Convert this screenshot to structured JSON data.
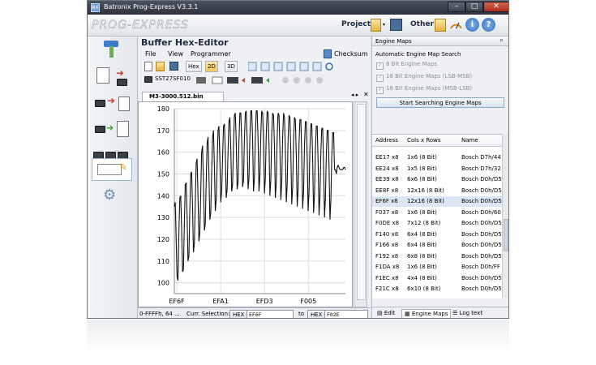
{
  "window": {
    "title": "Batronix Prog-Express V3.3.1",
    "app_icon": "BX",
    "min": "–",
    "max": "□",
    "close": "✕"
  },
  "header": {
    "logo": "PROG-EXPRESS",
    "project_label": "Project",
    "other_label": "Other"
  },
  "editor": {
    "title": "Buffer Hex-Editor",
    "menu": [
      "File",
      "View",
      "Programmer"
    ],
    "checksum_label": "Checksum",
    "hex_label": "Hex",
    "view_2d": "2D",
    "view_3d": "3D",
    "device": "SST27SF010",
    "doc_tab": "M3-3000.512.bin",
    "status": {
      "range": "0-FFFFh, 64 ...",
      "curr_selection_label": "Curr. Selection:",
      "hex": "HEX",
      "from": "EF6F",
      "to_label": "to",
      "to": "F02E"
    }
  },
  "engine_maps": {
    "title": "Engine Maps",
    "pin": "ᵖ",
    "search_label": "Automatic Engine Map Search",
    "options": [
      "8 Bit Engine Maps",
      "16 Bit Engine Maps (LSB-MSB)",
      "16 Bit Engine Maps (MSB-LSB)"
    ],
    "start_button": "Start Searching Engine Maps",
    "columns": [
      "Address",
      "Cols x Rows",
      "Name"
    ],
    "rows": [
      [
        "EE17 x8",
        "1x6 (8 Bit)",
        "Bosch D7h/44"
      ],
      [
        "EE24 x8",
        "1x5 (8 Bit)",
        "Bosch D7h/32"
      ],
      [
        "EE39 x8",
        "6x6 (8 Bit)",
        "Bosch D0h/D5"
      ],
      [
        "EE8F x8",
        "12x16 (8 Bit)",
        "Bosch D0h/D5"
      ],
      [
        "EF6F x8",
        "12x16 (8 Bit)",
        "Bosch D0h/D5"
      ],
      [
        "F037 x8",
        "1x6 (8 Bit)",
        "Bosch D0h/60"
      ],
      [
        "F0DE x8",
        "7x12 (8 Bit)",
        "Bosch D0h/D5"
      ],
      [
        "F140 x8",
        "6x4 (8 Bit)",
        "Bosch D0h/D5"
      ],
      [
        "F166 x8",
        "6x4 (8 Bit)",
        "Bosch D0h/D5"
      ],
      [
        "F192 x8",
        "8x8 (8 Bit)",
        "Bosch D0h/D5"
      ],
      [
        "F1DA x8",
        "1x6 (8 Bit)",
        "Bosch D0h/FF"
      ],
      [
        "F1EC x8",
        "4x4 (8 Bit)",
        "Bosch D0h/D5"
      ],
      [
        "F21C x8",
        "6x10 (8 Bit)",
        "Bosch D0h/D5"
      ]
    ],
    "tabs": [
      "Edit",
      "Engine Maps",
      "Log text"
    ]
  },
  "chart_data": {
    "type": "line",
    "title": "",
    "xlabel": "",
    "ylabel": "",
    "ylim": [
      95,
      180
    ],
    "yticks": [
      100,
      110,
      120,
      130,
      140,
      150,
      160,
      170,
      180
    ],
    "xticks": [
      "EF6F",
      "EFA1",
      "EFD3",
      "F005"
    ],
    "grid": true,
    "x": [
      0,
      1,
      2,
      3,
      4,
      5,
      6,
      7,
      8,
      9,
      10,
      11,
      12,
      13,
      14,
      15,
      16,
      17,
      18,
      19,
      20,
      21,
      22,
      23,
      24,
      25,
      26,
      27,
      28,
      29,
      30,
      31,
      32,
      33,
      34,
      35,
      36,
      37,
      38,
      39,
      40,
      41,
      42,
      43,
      44,
      45,
      46,
      47,
      48,
      49,
      50,
      51,
      52,
      53,
      54,
      55,
      56,
      57,
      58,
      59,
      60,
      61,
      62,
      63,
      64,
      65,
      66,
      67,
      68,
      69,
      70,
      71,
      72,
      73,
      74,
      75,
      76,
      77,
      78,
      79,
      80,
      81,
      82,
      83,
      84,
      85,
      86,
      87,
      88,
      89,
      90,
      91,
      92,
      93,
      94,
      95,
      96,
      97,
      98,
      99,
      100,
      101,
      102,
      103,
      104,
      105,
      106,
      107,
      108,
      109,
      110,
      111,
      112,
      113,
      114,
      115,
      116,
      117,
      118,
      119,
      120,
      121,
      122,
      123,
      124,
      125,
      126,
      127,
      128,
      129,
      130,
      131,
      132,
      133,
      134,
      135,
      136,
      137,
      138,
      139,
      140,
      141,
      142,
      143,
      144,
      145,
      146,
      147,
      148,
      149,
      150,
      151,
      152,
      153,
      154,
      155,
      156,
      157,
      158,
      159,
      160,
      161,
      162,
      163,
      164,
      165,
      166,
      167,
      168,
      169,
      170,
      171,
      172,
      173,
      174,
      175,
      176,
      177,
      178,
      179,
      180,
      181,
      182,
      183,
      184,
      185,
      186,
      187,
      188,
      189,
      190,
      191
    ],
    "values": [
      135,
      137,
      120,
      103,
      101,
      123,
      139,
      140,
      125,
      105,
      106,
      127,
      145,
      146,
      131,
      110,
      112,
      133,
      150,
      151,
      135,
      114,
      118,
      137,
      155,
      157,
      140,
      119,
      123,
      141,
      160,
      163,
      146,
      124,
      127,
      146,
      164,
      167,
      150,
      129,
      132,
      150,
      167,
      170,
      154,
      133,
      138,
      154,
      170,
      172,
      157,
      137,
      142,
      157,
      172,
      173,
      160,
      139,
      143,
      160,
      174,
      176,
      162,
      142,
      145,
      163,
      177,
      178,
      165,
      143,
      146,
      165,
      178,
      178,
      166,
      144,
      147,
      166,
      178,
      179,
      166,
      143,
      148,
      167,
      179,
      179,
      166,
      142,
      148,
      167,
      179,
      179,
      166,
      142,
      149,
      168,
      179,
      178,
      165,
      141,
      148,
      168,
      179,
      178,
      164,
      140,
      147,
      168,
      178,
      177,
      163,
      139,
      146,
      167,
      178,
      177,
      162,
      138,
      146,
      167,
      178,
      176,
      161,
      137,
      145,
      166,
      177,
      176,
      160,
      136,
      144,
      165,
      176,
      175,
      159,
      135,
      143,
      164,
      175,
      175,
      158,
      134,
      142,
      163,
      174,
      174,
      157,
      133,
      142,
      162,
      173,
      173,
      156,
      132,
      141,
      161,
      172,
      172,
      155,
      131,
      140,
      160,
      171,
      171,
      154,
      130,
      139,
      159,
      170,
      170,
      153,
      129,
      138,
      158,
      169,
      169,
      152,
      152,
      150,
      153,
      154,
      153,
      152,
      152,
      152,
      152,
      153,
      153,
      152
    ]
  }
}
